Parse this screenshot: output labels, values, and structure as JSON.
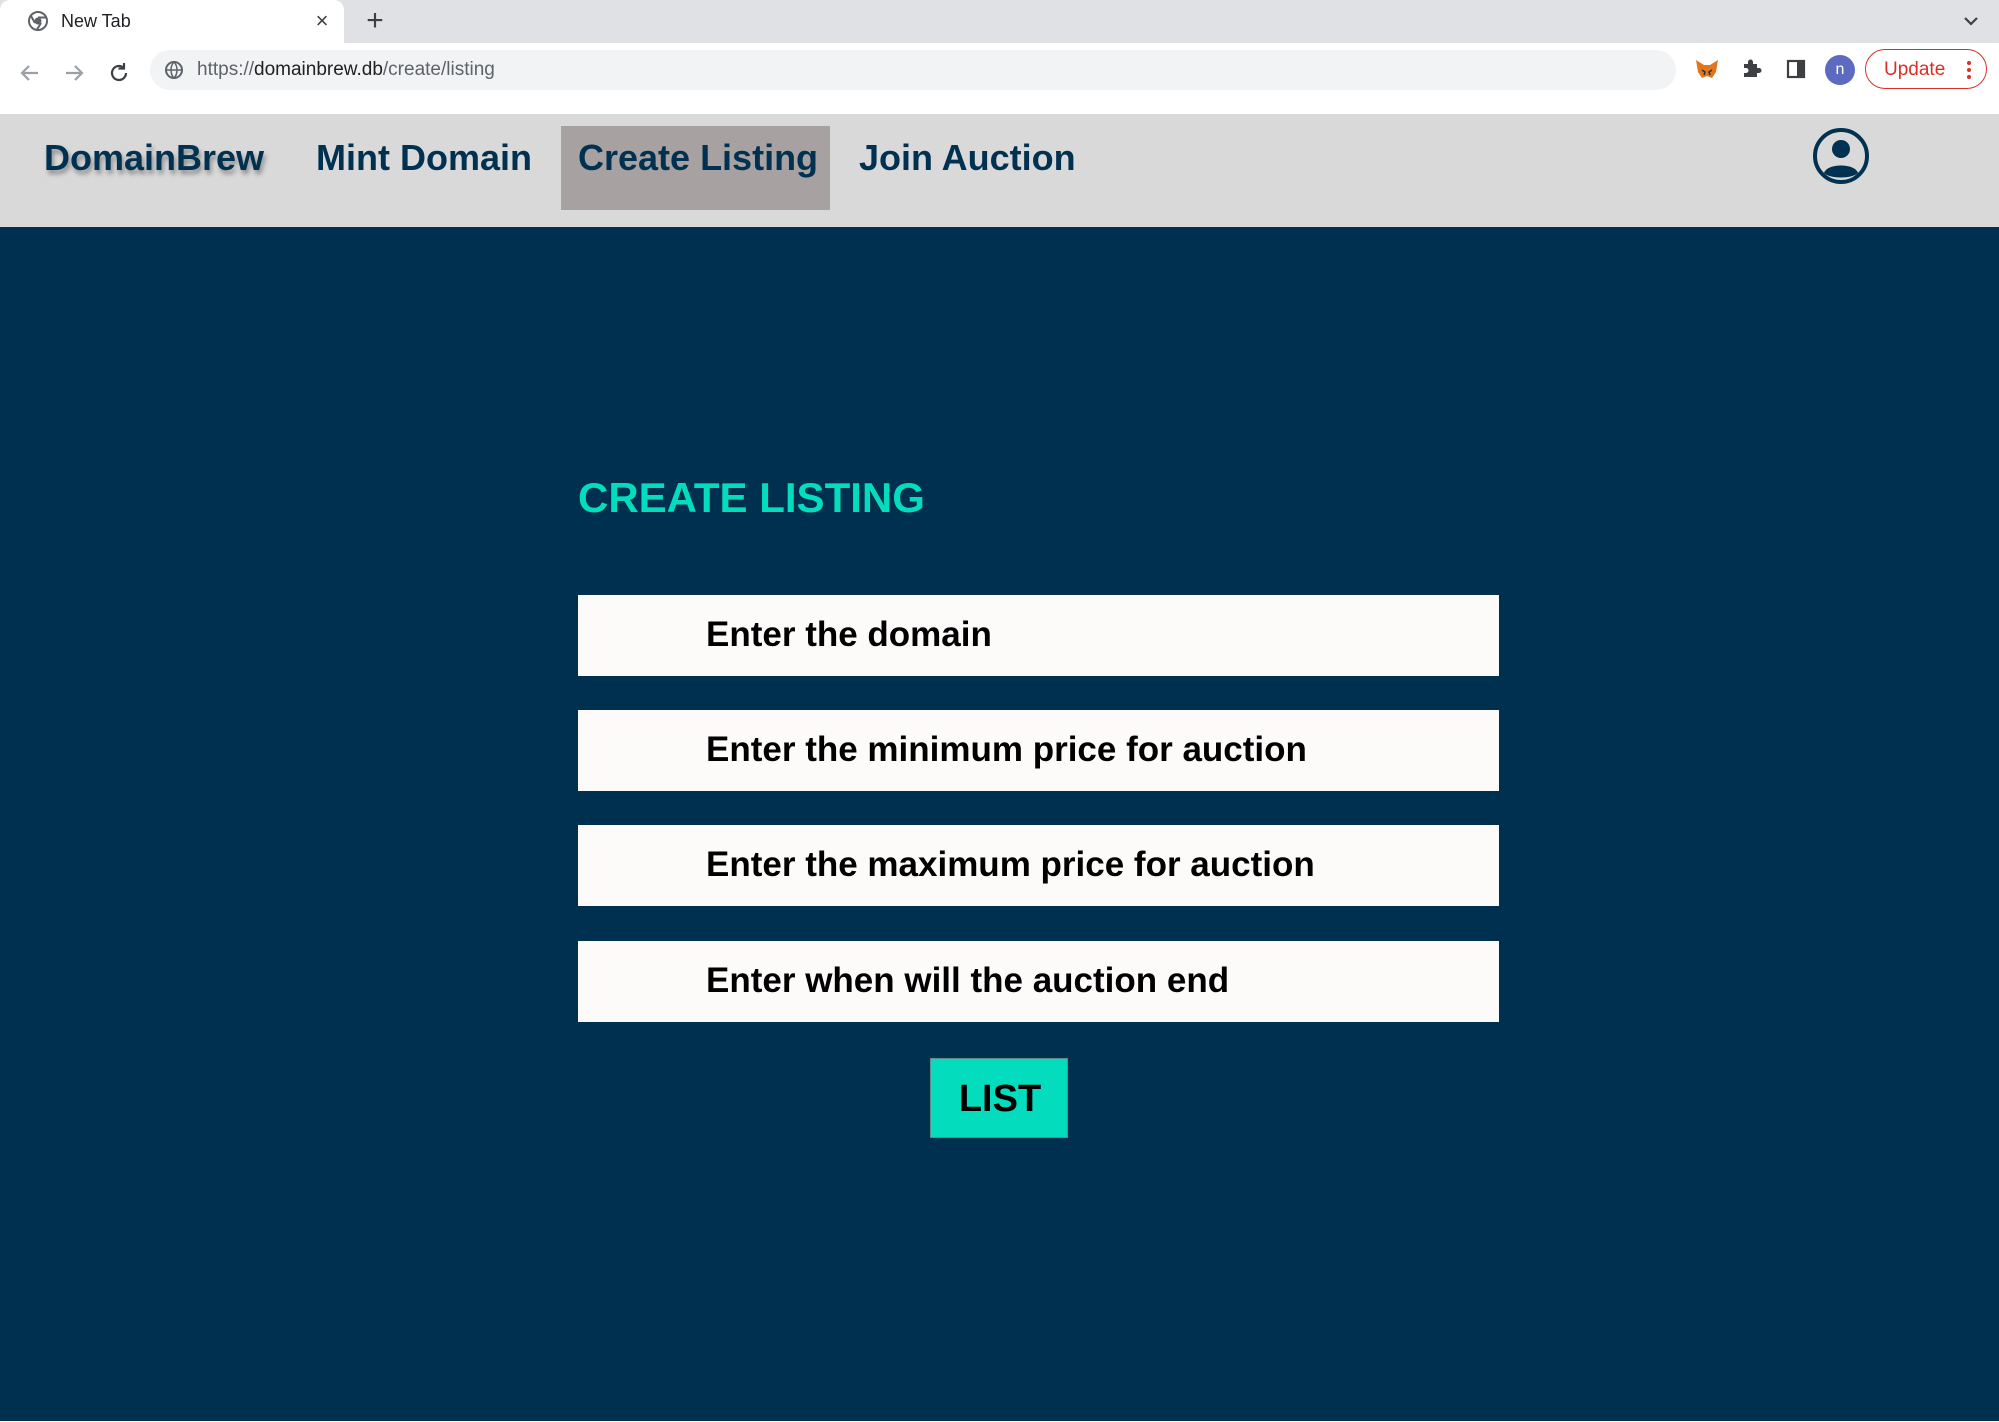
{
  "browser": {
    "tab_title": "New Tab",
    "tab_close": "×",
    "new_tab": "+",
    "url_prefix": "https://",
    "url_host": "domainbrew.db",
    "url_path": "/create/listing",
    "profile_initial": "n",
    "update_label": "Update"
  },
  "nav": {
    "brand": "DomainBrew",
    "links": [
      "Mint Domain",
      "Create Listing",
      "Join Auction"
    ],
    "active": "Create Listing"
  },
  "form": {
    "title": "CREATE LISTING",
    "fields": [
      "Enter the domain",
      "Enter the minimum price for auction",
      "Enter the maximum price for auction",
      "Enter when will the auction end"
    ],
    "submit_label": "LIST"
  },
  "colors": {
    "accent": "#03dcbd",
    "background": "#00304f",
    "navbar": "#d9d9d9",
    "active_tab": "#a7a1a1",
    "update": "#d93025"
  }
}
